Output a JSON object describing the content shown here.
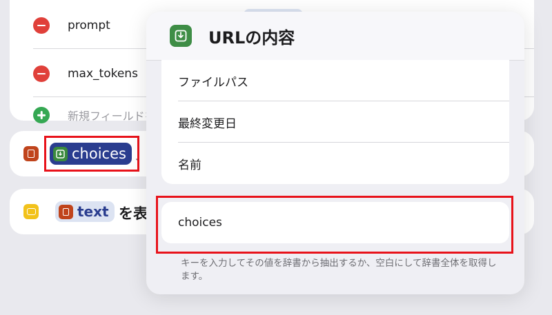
{
  "dictionary": {
    "fields": [
      {
        "key": "prompt"
      },
      {
        "key": "max_tokens"
      }
    ],
    "new_field_placeholder": "新規フィールドを"
  },
  "action_choices": {
    "token_label": "choices",
    "trailing": "、"
  },
  "action_show": {
    "token_label": "text",
    "trailing": "を表"
  },
  "popover": {
    "title": "URLの内容",
    "items": [
      {
        "label": "ファイルパス"
      },
      {
        "label": "最終変更日"
      },
      {
        "label": "名前"
      }
    ],
    "key_value": "choices",
    "help_text": "キーを入力してその値を辞書から抽出するか、空白にして辞書全体を取得します。"
  },
  "colors": {
    "highlight": "#e8121a",
    "token_dark": "#2a3d8f",
    "get_contents_icon": "#3e8d46",
    "dictionary_icon": "#c0441c",
    "show_icon": "#f2c21b"
  },
  "icons": {
    "minus": "minus-circle-icon",
    "plus": "plus-circle-icon",
    "get_contents": "download-tray-icon",
    "dictionary": "dictionary-icon",
    "show_result": "quick-look-icon"
  }
}
